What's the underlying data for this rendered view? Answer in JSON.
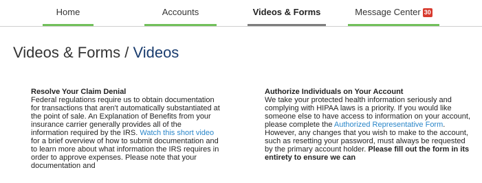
{
  "nav": {
    "tabs": [
      {
        "label": "Home"
      },
      {
        "label": "Accounts"
      },
      {
        "label": "Videos & Forms"
      },
      {
        "label": "Message Center"
      }
    ],
    "message_count": "30"
  },
  "page": {
    "title_prefix": "Videos & Forms / ",
    "title_current": "Videos"
  },
  "left": {
    "heading": "Resolve Your Claim Denial",
    "text_before": "Federal regulations require us to obtain documentation for transactions that aren't automatically substantiated at the point of sale. An Explanation of Benefits from your insurance carrier generally provides all of the information required by the IRS. ",
    "link": "Watch this short video",
    "text_after": " for a brief overview of how to submit documentation and to learn more about what information the IRS requires in order to approve expenses. Please note that your documentation and"
  },
  "right": {
    "heading": "Authorize Individuals on Your Account",
    "text_before": "We take your protected health information seriously and complying with HIPAA laws is a priority. If you would like someone else to have access to information on your account, please complete the ",
    "link": "Authorized Representative Form",
    "text_middle": ". However, any changes that you wish to make to the account, such as resetting your password, must always be requested by the primary account holder. ",
    "bold": "Please fill out the form in its entirety to ensure we can"
  },
  "colors": {
    "tab_accent": "#71c05a",
    "tab_active": "#7d7d7d",
    "link": "#2a86c9",
    "title_current": "#1a3c6e",
    "badge": "#d83a2e"
  }
}
